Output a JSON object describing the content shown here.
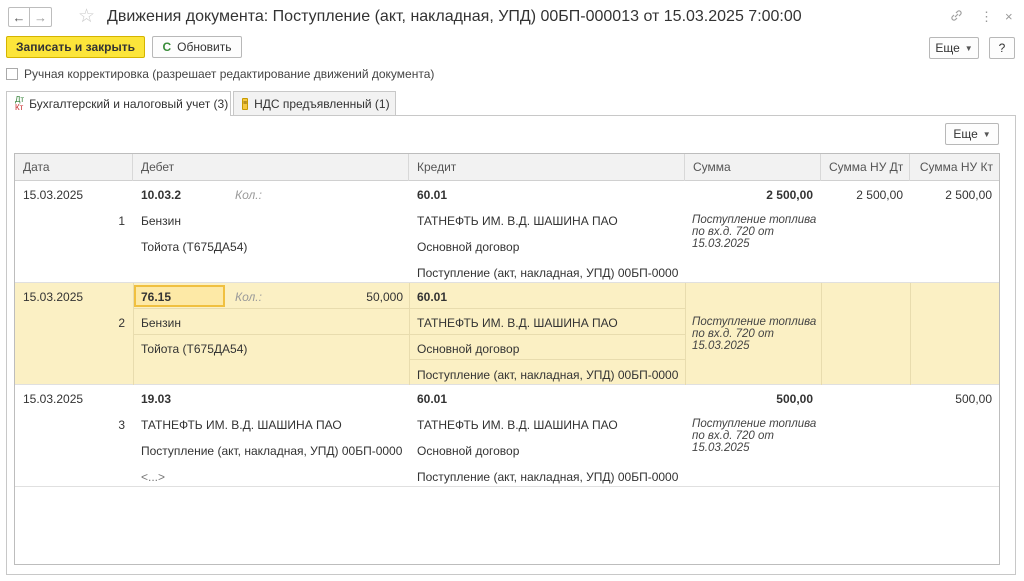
{
  "window": {
    "title": "Движения документа: Поступление (акт, накладная, УПД) 00БП-000013 от 15.03.2025 7:00:00",
    "back_icon": "←",
    "forward_icon": "→",
    "star_icon": "☆",
    "link_icon": "🔗",
    "menu_icon": "⋮",
    "close_icon": "×"
  },
  "toolbar": {
    "save_close_label": "Записать и закрыть",
    "refresh_icon": "C",
    "refresh_label": "Обновить",
    "more_label": "Еще",
    "help_label": "?"
  },
  "manual_edit": {
    "checked": false,
    "label": "Ручная корректировка (разрешает редактирование движений документа)"
  },
  "tabs": [
    {
      "icon_top": "Дт",
      "icon_bottom": "Кт",
      "label": "Бухгалтерский и налоговый учет (3)",
      "active": true
    },
    {
      "icon": "≡",
      "label": "НДС предъявленный (1)",
      "active": false
    }
  ],
  "panel": {
    "more_label": "Еще"
  },
  "table": {
    "columns": [
      "Дата",
      "Дебет",
      "Кредит",
      "Сумма",
      "Сумма НУ Дт",
      "Сумма НУ Кт"
    ],
    "rows": [
      {
        "date": "15.03.2025",
        "num": "1",
        "debit_account": "10.03.2",
        "qty_label": "Кол.:",
        "qty_value": "",
        "debit_sub1": "Бензин",
        "debit_sub2": "Тойота (Т675ДА54)",
        "debit_sub3": "",
        "credit_account": "60.01",
        "credit_sub1": "ТАТНЕФТЬ ИМ. В.Д. ШАШИНА ПАО",
        "credit_sub2": "Основной договор",
        "credit_sub3": "Поступление (акт, накладная, УПД) 00БП-0000...",
        "amount": "2 500,00",
        "content": "Поступление топлива по вх.д. 720 от 15.03.2025",
        "nu_dt": "2 500,00",
        "nu_kt": "2 500,00"
      },
      {
        "date": "15.03.2025",
        "num": "2",
        "debit_account": "76.15",
        "qty_label": "Кол.:",
        "qty_value": "50,000",
        "debit_sub1": "Бензин",
        "debit_sub2": "Тойота (Т675ДА54)",
        "debit_sub3": "",
        "credit_account": "60.01",
        "credit_sub1": "ТАТНЕФТЬ ИМ. В.Д. ШАШИНА ПАО",
        "credit_sub2": "Основной договор",
        "credit_sub3": "Поступление (акт, накладная, УПД) 00БП-0000...",
        "amount": "",
        "content": "Поступление топлива по вх.д. 720 от 15.03.2025",
        "nu_dt": "",
        "nu_kt": "",
        "selected": true
      },
      {
        "date": "15.03.2025",
        "num": "3",
        "debit_account": "19.03",
        "qty_label": "",
        "qty_value": "",
        "debit_sub1": "ТАТНЕФТЬ ИМ. В.Д. ШАШИНА ПАО",
        "debit_sub2": "Поступление (акт, накладная, УПД) 00БП-0000...",
        "debit_sub3": "<...>",
        "credit_account": "60.01",
        "credit_sub1": "ТАТНЕФТЬ ИМ. В.Д. ШАШИНА ПАО",
        "credit_sub2": "Основной договор",
        "credit_sub3": "Поступление (акт, накладная, УПД) 00БП-0000...",
        "amount": "500,00",
        "content": "Поступление топлива по вх.д. 720 от 15.03.2025",
        "nu_dt": "",
        "nu_kt": "500,00"
      }
    ]
  }
}
